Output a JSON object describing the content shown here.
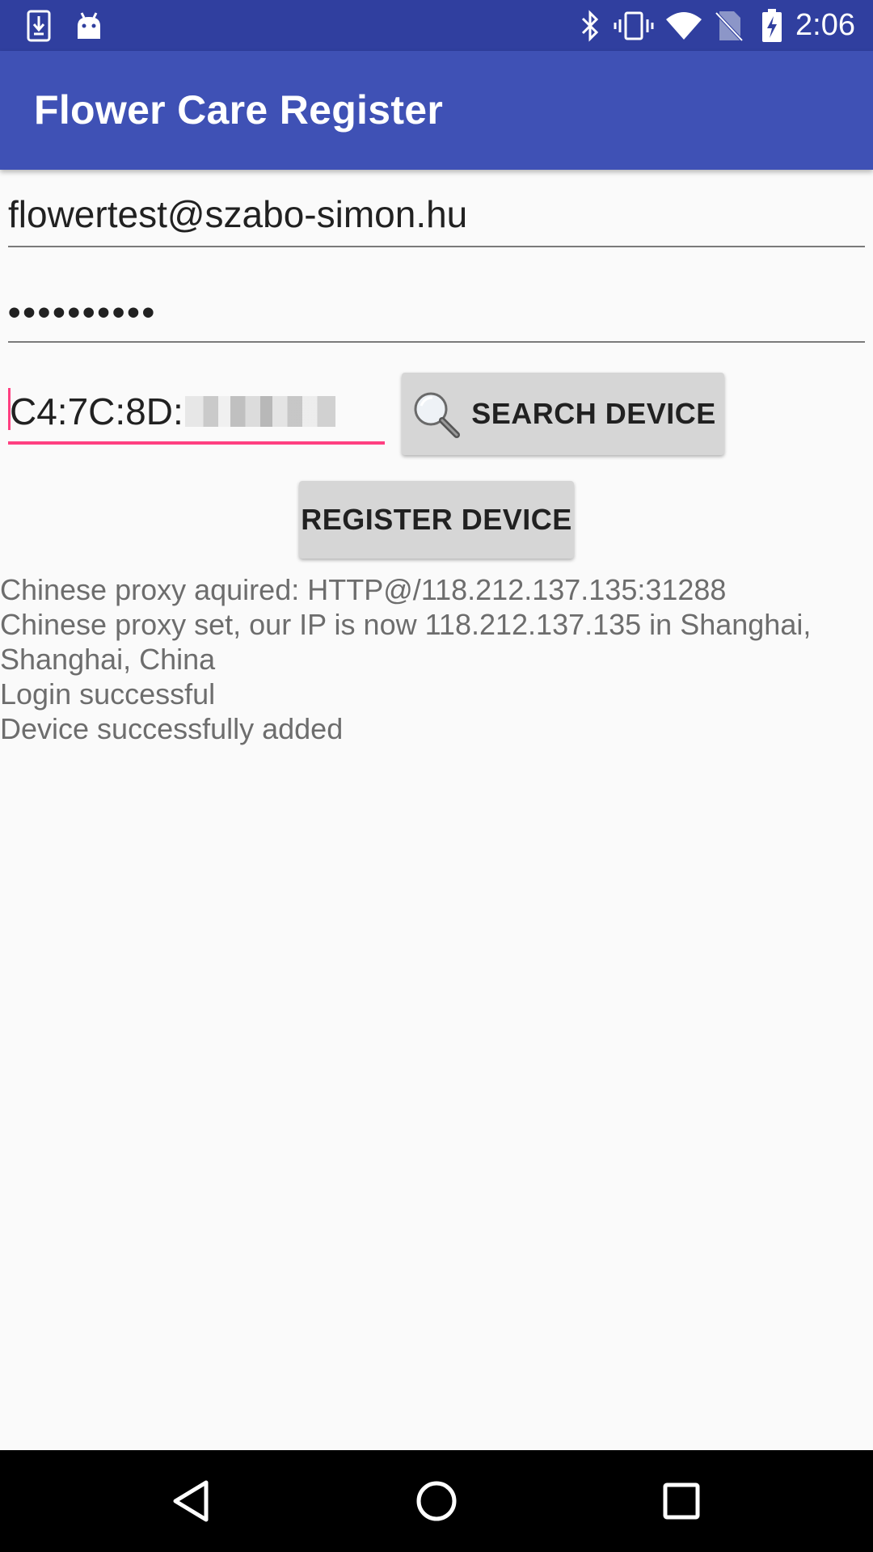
{
  "status_bar": {
    "time": "2:06",
    "left_icons": [
      "download-icon",
      "android-icon"
    ],
    "right_icons": [
      "bluetooth-icon",
      "vibrate-icon",
      "wifi-icon",
      "no-sim-icon",
      "battery-charging-icon"
    ]
  },
  "app_bar": {
    "title": "Flower Care Register",
    "color": "#3f51b5",
    "status_color": "#303f9f"
  },
  "form": {
    "email": "flowertest@szabo-simon.hu",
    "password_masked": "••••••••••",
    "mac_prefix": "C4:7C:8D:",
    "accent_color": "#ff4081"
  },
  "buttons": {
    "search_label": "SEARCH DEVICE",
    "search_icon": "magnifier-icon",
    "register_label": "REGISTER DEVICE"
  },
  "log": {
    "lines": [
      "Chinese proxy aquired: HTTP@/118.212.137.135:31288",
      "Chinese proxy set, our IP is now 118.212.137.135 in Shanghai, Shanghai, China",
      "Login successful",
      "Device successfully added"
    ]
  },
  "nav_bar": {
    "buttons": [
      "back-icon",
      "home-icon",
      "recents-icon"
    ]
  }
}
